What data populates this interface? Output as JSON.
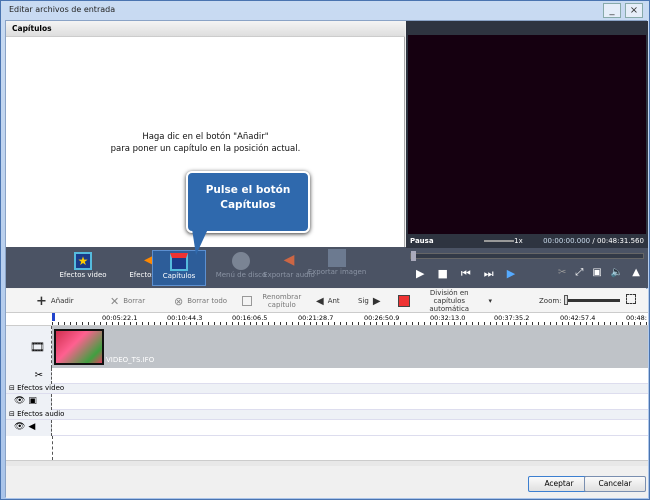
{
  "window": {
    "title": "Editar archivos de entrada",
    "minimize": "_",
    "close": "×"
  },
  "chapters": {
    "header": "Capítulos",
    "hint_line1": "Haga dic en el botón \"Añadir\"",
    "hint_line2": "para poner un capítulo en la posición actual."
  },
  "tooltip": {
    "line1": "Pulse el botón",
    "line2": "Capítulos"
  },
  "player": {
    "status": "Pausa",
    "speed": "1x",
    "current_time": "00:00:00.000",
    "total_time": "/ 00:48:31.560",
    "speed_slider": 0.5,
    "position": 0
  },
  "tools": [
    {
      "label": "Efectos video",
      "enabled": true
    },
    {
      "label": "Efectos audio",
      "enabled": true
    },
    {
      "label": "Capítulos",
      "enabled": true,
      "selected": true
    },
    {
      "label": "Menú de disco",
      "enabled": false
    },
    {
      "label": "Exportar audio",
      "enabled": false
    },
    {
      "label": "Exportar imagen",
      "enabled": false
    }
  ],
  "toolbar": {
    "add": "Añadir",
    "delete": "Borrar",
    "delete_all": "Borrar todo",
    "rename": "Renombrar capítulo",
    "prev": "Ant",
    "next": "Sig",
    "auto_split": "División en capítulos automática",
    "zoom": "Zoom:"
  },
  "ruler": [
    "00:05:22.1",
    "00:10:44.3",
    "00:16:06.5",
    "00:21:28.7",
    "00:26:50.9",
    "00:32:13.0",
    "00:37:35.2",
    "00:42:57.4",
    "00:48:"
  ],
  "timeline": {
    "clip_name": "VIDEO_TS.IFO",
    "video_effects": "Efectos video",
    "audio_effects": "Efectos audio"
  },
  "buttons": {
    "ok": "Aceptar",
    "cancel": "Cancelar"
  }
}
